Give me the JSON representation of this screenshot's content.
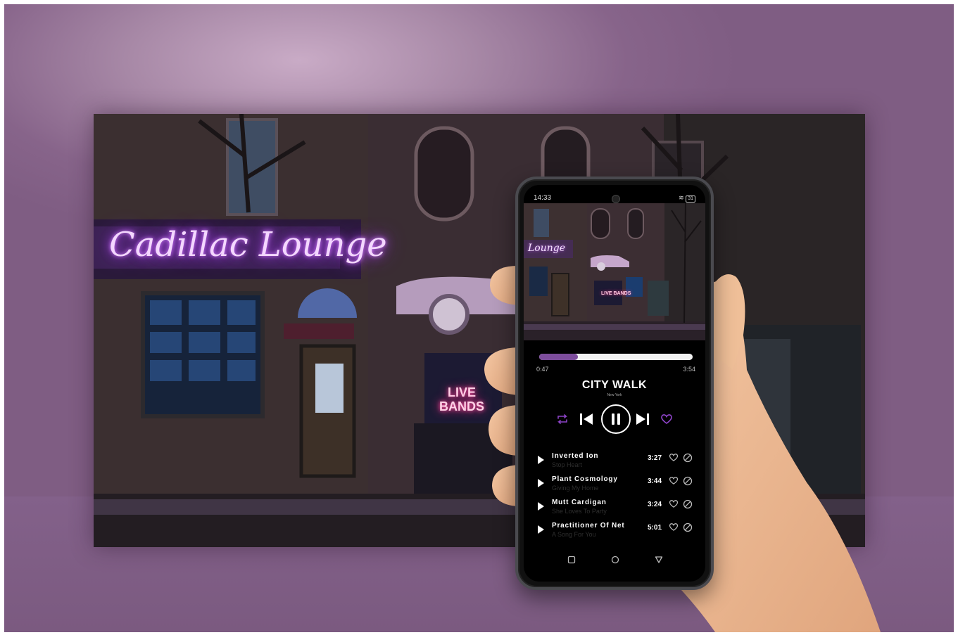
{
  "background_image": {
    "sign_text": "Cadillac Lounge",
    "window_sign_text": "LIVE BANDS"
  },
  "phone": {
    "status": {
      "time": "14:33",
      "battery": "31"
    },
    "player": {
      "progress": 0.25,
      "elapsed": "0:47",
      "total": "3:54",
      "title": "CITY WALK",
      "subtitle": "New York",
      "accent": "#8e44c9",
      "cover_sign_text": "Lounge",
      "cover_live_text": "LIVE BANDS"
    },
    "controls": [
      "repeat-icon",
      "previous-icon",
      "pause-icon",
      "next-icon",
      "heart-icon"
    ],
    "tracks": [
      {
        "name": "Inverted Ion",
        "artist": "Stop Heart",
        "duration": "3:27"
      },
      {
        "name": "Plant Cosmology",
        "artist": "Giving My Home",
        "duration": "3:44"
      },
      {
        "name": "Mutt Cardigan",
        "artist": "She Loves To Party",
        "duration": "3:24"
      },
      {
        "name": "Practitioner Of Net",
        "artist": "A Song For You",
        "duration": "5:01"
      }
    ],
    "nav": [
      "recent-apps-icon",
      "home-icon",
      "back-icon"
    ]
  }
}
